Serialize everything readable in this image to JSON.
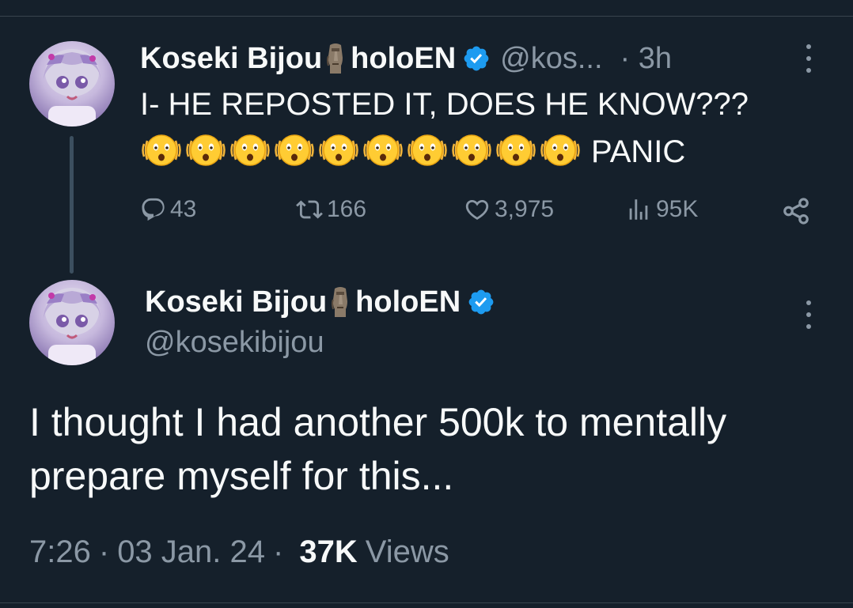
{
  "parent_tweet": {
    "author": {
      "name": "Koseki Bijou",
      "name_suffix": "holoEN",
      "handle": "@kos...",
      "verified": true
    },
    "time": "· 3h",
    "text_line1": "I- HE REPOSTED IT, DOES HE KNOW???",
    "emoji_name": "face-with-open-mouth-shaking",
    "emoji_count": 10,
    "text_line2": "PANIC",
    "stats": {
      "replies": "43",
      "reposts": "166",
      "likes": "3,975",
      "views": "95K"
    }
  },
  "main_tweet": {
    "author": {
      "name": "Koseki Bijou",
      "name_suffix": "holoEN",
      "handle": "@kosekibijou",
      "verified": true
    },
    "text": "I thought I had another 500k to mentally prepare myself for this...",
    "time": "7:26",
    "date": "03 Jan. 24",
    "views_count": "37K",
    "views_label": "Views"
  },
  "colors": {
    "background": "#15202b",
    "text_primary": "#f7f9f9",
    "text_secondary": "#8b98a5",
    "verified_blue": "#1d9bf0",
    "divider": "#38444d"
  },
  "icons": [
    "more-icon",
    "reply-icon",
    "repost-icon",
    "like-icon",
    "views-icon",
    "share-icon",
    "verified-badge-icon",
    "moai-icon"
  ]
}
